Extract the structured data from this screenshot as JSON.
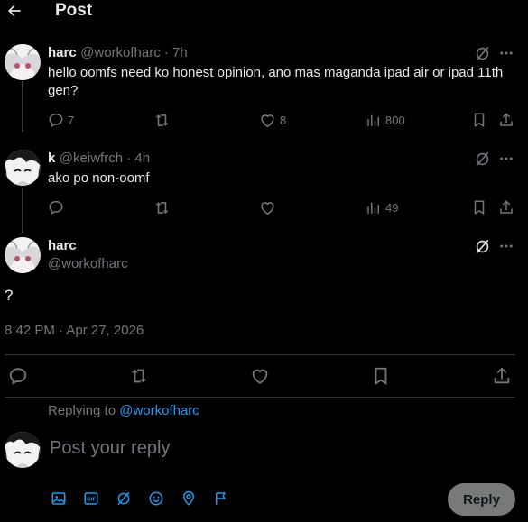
{
  "header": {
    "title": "Post"
  },
  "colors": {
    "accent": "#1d9bf0",
    "muted": "#71767b",
    "text": "#e7e9ea",
    "reply_button_bg": "#787a7a"
  },
  "posts": [
    {
      "name": "harc",
      "handle_time": "@workofharc · 7h",
      "text": "hello oomfs need ko honest opinion, ano mas maganda ipad air or ipad 11th gen?",
      "replies": "7",
      "likes": "8",
      "views": "800"
    },
    {
      "name": "k",
      "handle_time": "@keiwfrch · 4h",
      "text": "ako po non-oomf",
      "views": "49"
    }
  ],
  "main_post": {
    "name": "harc",
    "handle": "@workofharc",
    "text": "?",
    "timestamp": "8:42 PM · Apr 27, 2026"
  },
  "composer": {
    "replying_to_label": "Replying to",
    "replying_to_handle": "@workofharc",
    "placeholder": "Post your reply",
    "reply_button": "Reply"
  },
  "icons": [
    "back-arrow-icon",
    "grok-icon",
    "more-icon",
    "reply-icon",
    "repost-icon",
    "like-icon",
    "views-icon",
    "bookmark-icon",
    "share-icon",
    "image-icon",
    "gif-icon",
    "grok-icon",
    "emoji-icon",
    "location-icon",
    "flag-icon"
  ]
}
